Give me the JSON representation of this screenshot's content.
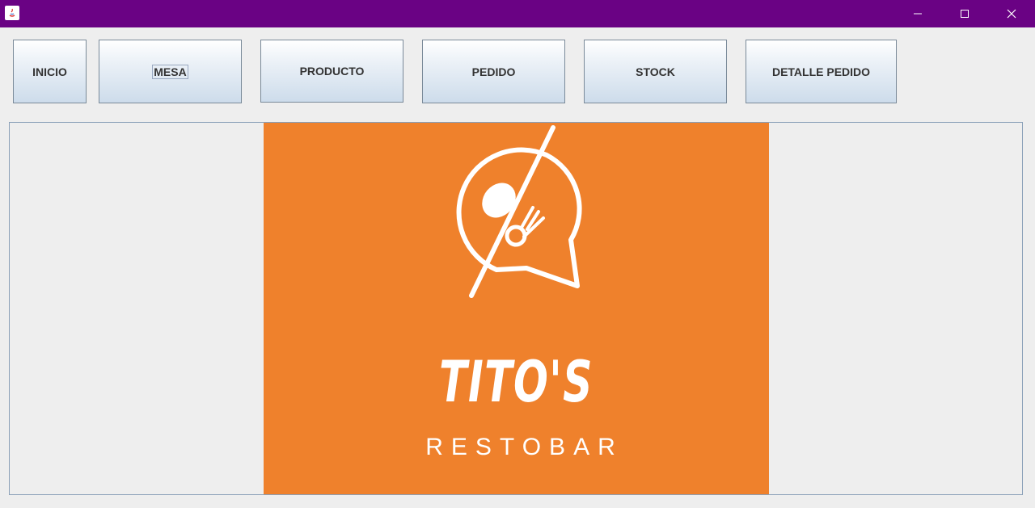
{
  "window": {
    "title": "",
    "controls": [
      "minimize-icon",
      "maximize-icon",
      "close-icon"
    ],
    "title_bar_color": "#6a0284"
  },
  "toolbar": {
    "buttons": [
      {
        "label": "INICIO"
      },
      {
        "label": "MESA"
      },
      {
        "label": "PRODUCTO"
      },
      {
        "label": "PEDIDO"
      },
      {
        "label": "STOCK"
      },
      {
        "label": "DETALLE PEDIDO"
      }
    ]
  },
  "logo": {
    "name": "TITO'S",
    "subtitle": "RESTOBAR",
    "background_color": "#ef812c",
    "icon": "chat-bubble-spoon-fork-icon"
  }
}
